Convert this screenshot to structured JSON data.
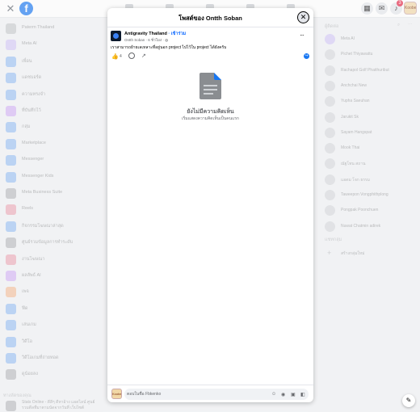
{
  "topbar": {
    "close_glyph": "✕",
    "logo_letter": "f",
    "grid_icon": "grid-icon",
    "messenger_icon": "messenger-icon",
    "notification_icon": "bell-icon",
    "notification_count": "3",
    "profile_initial": "Koobe"
  },
  "left_sidebar": {
    "items": [
      {
        "label": "Paterm Thailand",
        "color": "#8a8d91"
      },
      {
        "label": "Meta AI",
        "color": "#a78bfa"
      },
      {
        "label": "เพื่อน",
        "color": "#1877f2"
      },
      {
        "label": "แดชบอร์ด",
        "color": "#1877f2"
      },
      {
        "label": "ความทรงจำ",
        "color": "#1877f2"
      },
      {
        "label": "ที่บันทึกไว้",
        "color": "#a855f7"
      },
      {
        "label": "กลุ่ม",
        "color": "#1877f2"
      },
      {
        "label": "Marketplace",
        "color": "#1877f2"
      },
      {
        "label": "Messenger",
        "color": "#1877f2"
      },
      {
        "label": "Messenger Kids",
        "color": "#1877f2"
      },
      {
        "label": "Meta Business Suite",
        "color": "#65676b"
      },
      {
        "label": "Reels",
        "color": "#e4405f"
      },
      {
        "label": "กิจกรรมโฆษณาล่าสุด",
        "color": "#1877f2"
      },
      {
        "label": "ศูนย์รวมข้อมูลการทำระดับ",
        "color": "#65676b"
      },
      {
        "label": "งานโฆษณา",
        "color": "#e4405f"
      },
      {
        "label": "ผลลัพธ์ AI",
        "color": "#a855f7"
      },
      {
        "label": "เพจ",
        "color": "#f97316"
      },
      {
        "label": "ฟีด",
        "color": "#1877f2"
      },
      {
        "label": "เล่นเกม",
        "color": "#1877f2"
      },
      {
        "label": "วิดีโอ",
        "color": "#1877f2"
      },
      {
        "label": "วิดีโอเกมที่ถ่ายทอด",
        "color": "#1877f2"
      },
      {
        "label": "ดูน้อยลง",
        "color": "#65676b"
      }
    ],
    "shortcuts_heading": "ทางลัดของคุณ",
    "shortcut_text": "Stats Online - ดีลีๆ ดีหาอ้าง แอดไลน์ ศูนย์ รวมดีลที่มาตามนัดจากวันที่ เว็บไซต์"
  },
  "right_sidebar": {
    "contacts_heading": "ผู้ติดต่อ",
    "contacts": [
      "Meta AI",
      "Pichet Thiyawattu",
      "Rachapol Golf Phaithuribut",
      "Anchchai New",
      "Yupha Saeuhan",
      "Jarukit Sk",
      "Sayam Hangspat",
      "Mook Thai",
      "ณัฐโทน สถาน",
      "แอดม โจก ธรรม",
      "Taweepon Vongphithplong",
      "Pongpak Poonchuen",
      "Nuwat Chatmin adirek"
    ],
    "groups_heading": "แชทกลุ่ม",
    "create_group_label": "สร้างกลุ่มใหม่"
  },
  "dialog": {
    "title": "โพสต์ของ Ontth Soban",
    "close_glyph": "✕",
    "post": {
      "page_name": "Antigravity Thailand",
      "join_label": "· เข้าร่วม",
      "meta": "Ontth Soban · 6 ชั่วโมง ·",
      "text": "เราสามารถย้ายเลเหลาะที่อยู่นอก project ไปไว้ใน project ได้ยังครับ",
      "like_count": "4",
      "more_glyph": "···"
    },
    "empty_state": {
      "title": "ยังไม่มีความคิดเห็น",
      "subtitle": "เริ่มแสดงความคิดเห็นเป็นคนแรก"
    },
    "comment_input": {
      "placeholder": "ตอบในชื่อ Fbkenko"
    }
  },
  "colors": {
    "accent": "#1877f2",
    "doc_icon": "#8a8d91"
  }
}
